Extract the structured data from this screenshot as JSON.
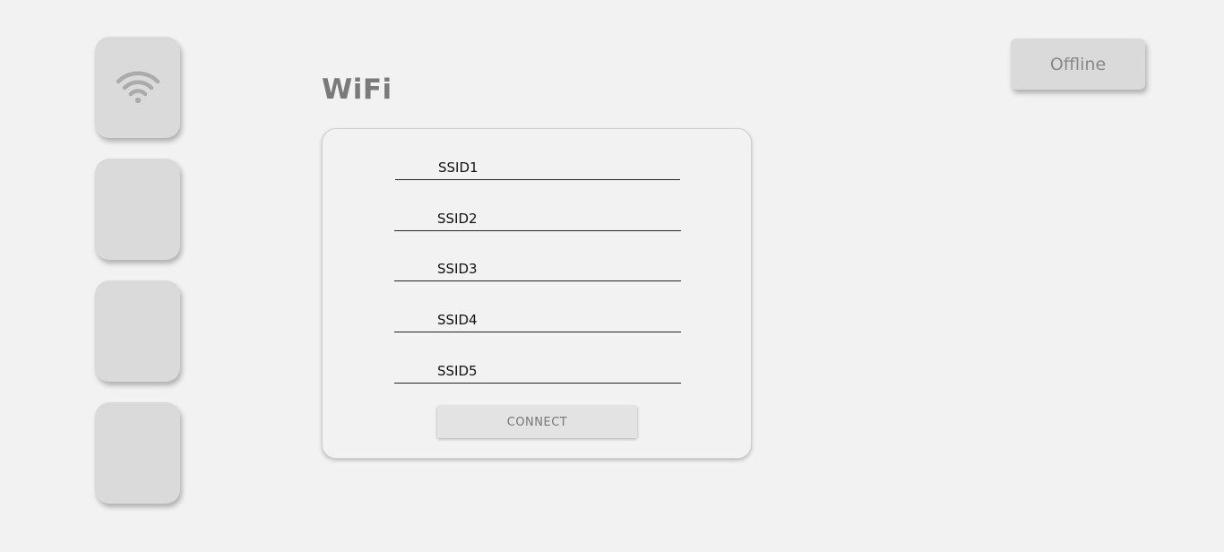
{
  "sidebar": {
    "items": [
      {
        "icon": "wifi-icon",
        "label": ""
      },
      {
        "icon": "",
        "label": ""
      },
      {
        "icon": "",
        "label": ""
      },
      {
        "icon": "",
        "label": ""
      }
    ],
    "icon_color": "#ababab"
  },
  "header": {
    "title": "WiFi"
  },
  "status": {
    "label": "Offline"
  },
  "wifi_form": {
    "fields": [
      {
        "label": "SSID1",
        "value": ""
      },
      {
        "label": "SSID2",
        "value": ""
      },
      {
        "label": "SSID3",
        "value": ""
      },
      {
        "label": "SSID4",
        "value": ""
      },
      {
        "label": "SSID5",
        "value": ""
      }
    ],
    "connect_label": "CONNECT"
  },
  "colors": {
    "background": "#f2f2f2",
    "tile": "#dadada",
    "title_text": "#7a7a7a"
  }
}
